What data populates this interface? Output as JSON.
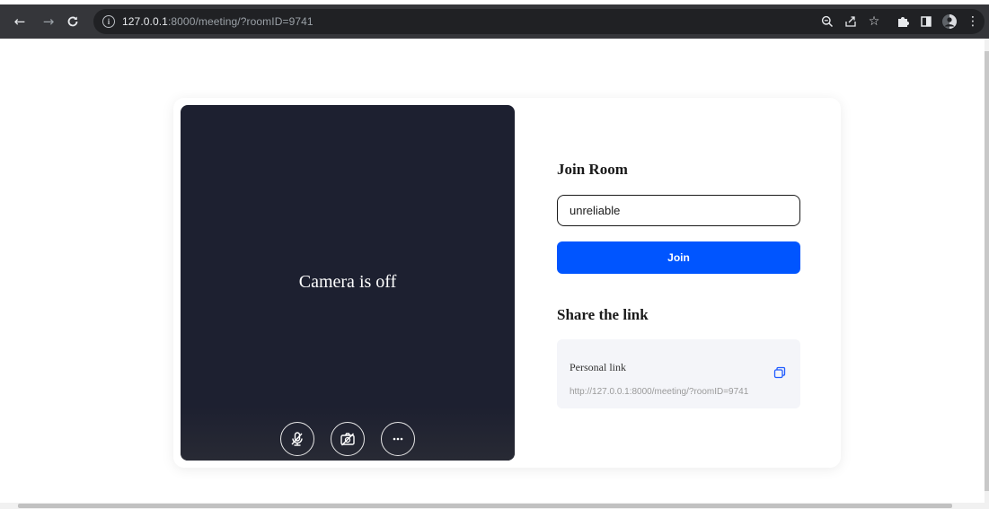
{
  "browser": {
    "url_host": "127.0.0.1",
    "url_rest": ":8000/meeting/?roomID=9741",
    "icons": [
      "back-arrow-icon",
      "forward-arrow-icon",
      "reload-icon",
      "info-icon",
      "zoom-icon",
      "share-icon",
      "bookmark-star-icon",
      "extensions-puzzle-icon",
      "side-panel-icon",
      "profile-avatar-icon",
      "more-vert-icon"
    ]
  },
  "video": {
    "camera_off_text": "Camera is off",
    "controls": [
      "mic-off-icon",
      "camera-off-icon",
      "more-options-icon"
    ],
    "background_color": "#1d2030"
  },
  "join": {
    "heading": "Join Room",
    "input_value": "unreliable",
    "button_label": "Join",
    "button_color": "#0055ff"
  },
  "share": {
    "heading": "Share the link",
    "link_label": "Personal link",
    "link_url": "http://127.0.0.1:8000/meeting/?roomID=9741"
  }
}
